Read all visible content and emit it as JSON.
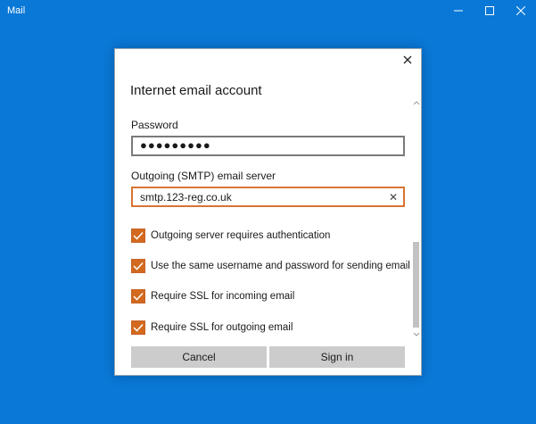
{
  "window": {
    "title": "Mail"
  },
  "dialog": {
    "title": "Internet email account",
    "password": {
      "label": "Password",
      "value": "●●●●●●●●●"
    },
    "smtp": {
      "label": "Outgoing (SMTP) email server",
      "value": "smtp.123-reg.co.uk"
    },
    "options": [
      {
        "label": "Outgoing server requires authentication",
        "checked": true
      },
      {
        "label": "Use the same username and password for sending email",
        "checked": true
      },
      {
        "label": "Require SSL for incoming email",
        "checked": true
      },
      {
        "label": "Require SSL for outgoing email",
        "checked": true
      }
    ],
    "cancel_label": "Cancel",
    "signin_label": "Sign in"
  },
  "colors": {
    "background": "#0a78d7",
    "accent": "#d2691e",
    "button": "#cccccc"
  },
  "icons": [
    "minimize-icon",
    "maximize-icon",
    "close-icon",
    "clear-icon",
    "checkmark-icon",
    "chevron-up-icon",
    "chevron-down-icon"
  ]
}
